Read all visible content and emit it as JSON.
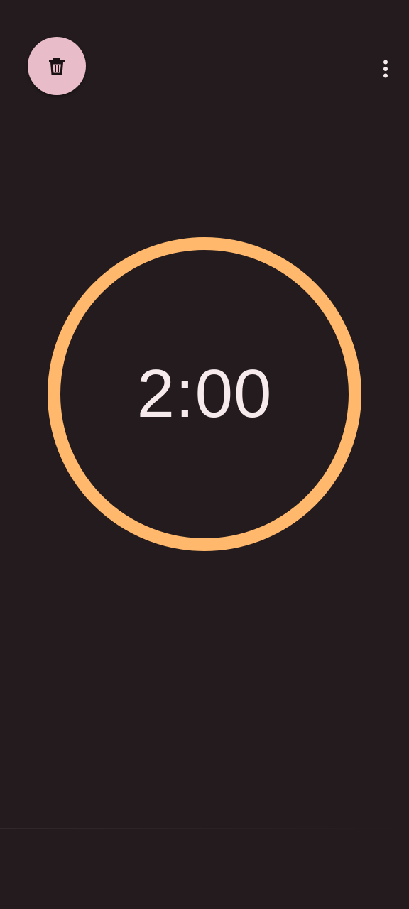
{
  "toolbar": {
    "delete_icon": "trash-icon",
    "overflow_icon": "more-vert-icon"
  },
  "timer": {
    "time": "2:00",
    "ring_color": "#ffb86c",
    "progress": 1.0
  },
  "colors": {
    "background": "#231b1d",
    "delete_button_bg": "#e8bcc8",
    "text": "#f6eaec"
  }
}
